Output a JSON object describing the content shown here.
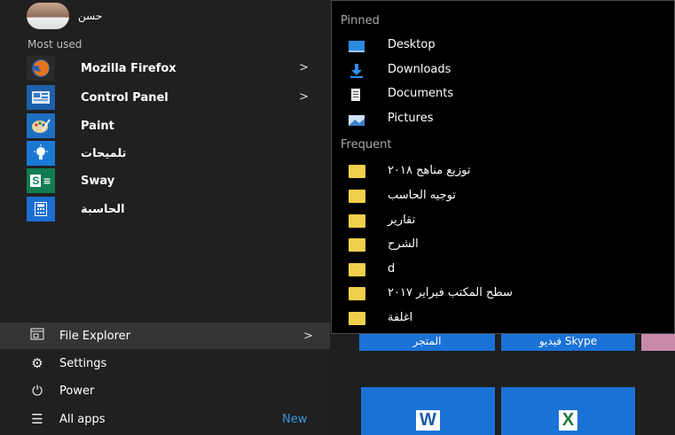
{
  "user": {
    "name": "حسن"
  },
  "most_used": {
    "label": "Most used",
    "items": [
      {
        "label": "Mozilla Firefox",
        "icon": "firefox-icon",
        "arrow": ">",
        "tile_color": "#2a2a2a"
      },
      {
        "label": "Control Panel",
        "icon": "control-panel-icon",
        "arrow": ">",
        "tile_color": "#1e5fa8"
      },
      {
        "label": "Paint",
        "icon": "paint-icon",
        "arrow": "",
        "tile_color": "#1f6fc1"
      },
      {
        "label": "تلميحات",
        "icon": "tips-icon",
        "arrow": "",
        "tile_color": "#1b79d6"
      },
      {
        "label": "Sway",
        "icon": "sway-icon",
        "arrow": "",
        "tile_color": "#117c52"
      },
      {
        "label": "الحاسبة",
        "icon": "calculator-icon",
        "arrow": "",
        "tile_color": "#1b6fd0"
      }
    ]
  },
  "bottom": {
    "file_explorer": {
      "label": "File Explorer",
      "arrow": ">",
      "icon": "file-explorer-icon"
    },
    "settings": {
      "label": "Settings",
      "icon": "gear-icon"
    },
    "power": {
      "label": "Power",
      "icon": "power-icon"
    },
    "all_apps": {
      "label": "All apps",
      "badge": "New",
      "icon": "list-icon"
    }
  },
  "jump_list": {
    "pinned_label": "Pinned",
    "pinned": [
      {
        "label": "Desktop",
        "icon": "desktop-icon"
      },
      {
        "label": "Downloads",
        "icon": "downloads-icon"
      },
      {
        "label": "Documents",
        "icon": "documents-icon"
      },
      {
        "label": "Pictures",
        "icon": "pictures-icon"
      }
    ],
    "frequent_label": "Frequent",
    "frequent": [
      {
        "label": "توزيع مناهج ٢٠١٨",
        "icon": "folder-icon"
      },
      {
        "label": "توجيه الحاسب",
        "icon": "folder-icon"
      },
      {
        "label": "تقارير",
        "icon": "folder-icon"
      },
      {
        "label": "الشرح",
        "icon": "folder-icon"
      },
      {
        "label": "d",
        "icon": "folder-icon"
      },
      {
        "label": "سطح المكتب فبراير ٢٠١٧",
        "icon": "folder-icon"
      },
      {
        "label": "اغلفة",
        "icon": "folder-icon"
      }
    ]
  },
  "tiles": {
    "store_label": "المتجر",
    "skype_label": "فيديو Skype",
    "word_label": "W",
    "excel_label": "X"
  },
  "colors": {
    "tile_blue": "#1a72d6",
    "folder": "#f2cf4b",
    "accent": "#3a96dd"
  }
}
